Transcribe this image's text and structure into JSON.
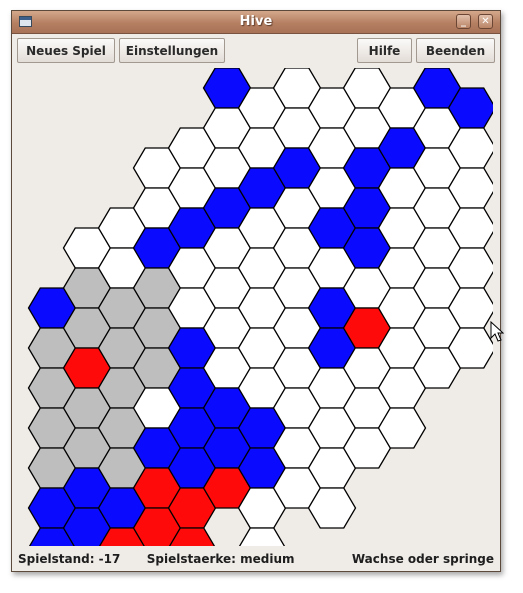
{
  "window": {
    "title": "Hive",
    "minimize_glyph": "_",
    "close_glyph": "✕"
  },
  "toolbar": {
    "new_game": "Neues Spiel",
    "settings": "Einstellungen",
    "help": "Hilfe",
    "quit": "Beenden"
  },
  "colors": {
    "empty": "#ffffff",
    "blue": "#0a0aff",
    "red": "#ff0a0a",
    "gray": "#bdbebd",
    "stroke": "#000000"
  },
  "board": {
    "columns": [
      {
        "row0": 5,
        "cells": "BGGGGBB"
      },
      {
        "row0": 4,
        "cells": "WGGRGGBB"
      },
      {
        "row0": 3,
        "cells": "WWGGGGGBR"
      },
      {
        "row0": 2,
        "cells": "WWBGGGWBRR"
      },
      {
        "row0": 1,
        "cells": "WWBWWBBBBRR"
      },
      {
        "row0": 0,
        "cells": "BWWBWWWWBBR"
      },
      {
        "row0": 0,
        "cells": "WWBWWWWWBBWW"
      },
      {
        "row0": 0,
        "cells": "WWBWWWWWWWW"
      },
      {
        "row0": 0,
        "cells": "WWWBWBBWWWW"
      },
      {
        "row0": 0,
        "cells": "WWBBBWRWWW"
      },
      {
        "row0": 0,
        "cells": "WBWWWWWWW"
      },
      {
        "row0": 0,
        "cells": "BWWWWWWW"
      },
      {
        "row0": 0,
        "cells": "BWWWWWW"
      }
    ]
  },
  "status": {
    "score": "Spielstand: -17",
    "strength": "Spielstaerke: medium",
    "hint": "Wachse oder springe"
  }
}
